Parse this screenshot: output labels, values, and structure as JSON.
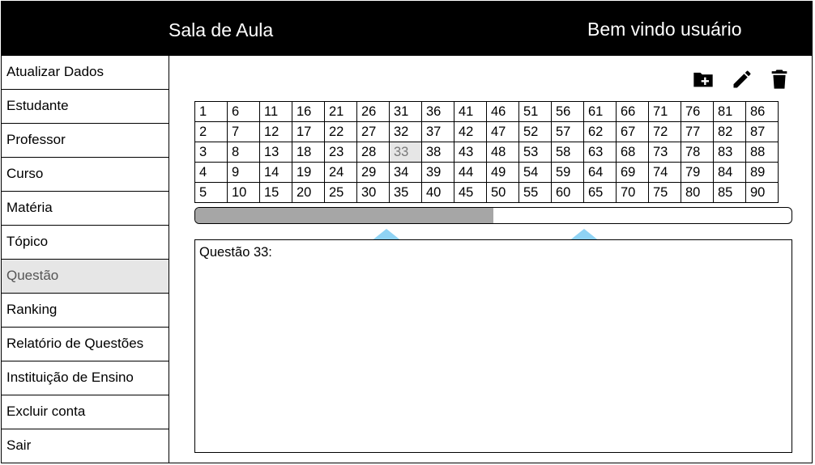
{
  "header": {
    "title": "Sala de Aula",
    "welcome": "Bem vindo usuário"
  },
  "sidebar": {
    "items": [
      {
        "label": "Atualizar Dados"
      },
      {
        "label": "Estudante"
      },
      {
        "label": "Professor"
      },
      {
        "label": "Curso"
      },
      {
        "label": "Matéria"
      },
      {
        "label": "Tópico"
      },
      {
        "label": "Questão",
        "active": true
      },
      {
        "label": "Ranking"
      },
      {
        "label": "Relatório de Questões"
      },
      {
        "label": "Instituição de Ensino"
      },
      {
        "label": "Excluir conta"
      },
      {
        "label": "Sair"
      }
    ]
  },
  "toolbar": {
    "icons": [
      "add-folder-icon",
      "edit-pencil-icon",
      "delete-trash-icon"
    ]
  },
  "question_grid": {
    "rows": [
      [
        "1",
        "6",
        "11",
        "16",
        "21",
        "26",
        "31",
        "36",
        "41",
        "46",
        "51",
        "56",
        "61",
        "66",
        "71",
        "76",
        "81",
        "86"
      ],
      [
        "2",
        "7",
        "12",
        "17",
        "22",
        "27",
        "32",
        "37",
        "42",
        "47",
        "52",
        "57",
        "62",
        "67",
        "72",
        "77",
        "82",
        "87"
      ],
      [
        "3",
        "8",
        "13",
        "18",
        "23",
        "28",
        "33",
        "38",
        "43",
        "48",
        "53",
        "58",
        "63",
        "68",
        "73",
        "78",
        "83",
        "88"
      ],
      [
        "4",
        "9",
        "14",
        "19",
        "24",
        "29",
        "34",
        "39",
        "44",
        "49",
        "54",
        "59",
        "64",
        "69",
        "74",
        "79",
        "84",
        "89"
      ],
      [
        "5",
        "10",
        "15",
        "20",
        "25",
        "30",
        "35",
        "40",
        "45",
        "50",
        "55",
        "60",
        "65",
        "70",
        "75",
        "80",
        "85",
        "90"
      ]
    ],
    "selected": "33",
    "scroll_fraction": 0.5
  },
  "question": {
    "label": "Questão 33:"
  },
  "colors": {
    "header_bg": "#000000",
    "selected_bg": "#e6e6e6",
    "scroll_thumb": "#a6a6a6",
    "background_accent": "#8fd3f4"
  }
}
